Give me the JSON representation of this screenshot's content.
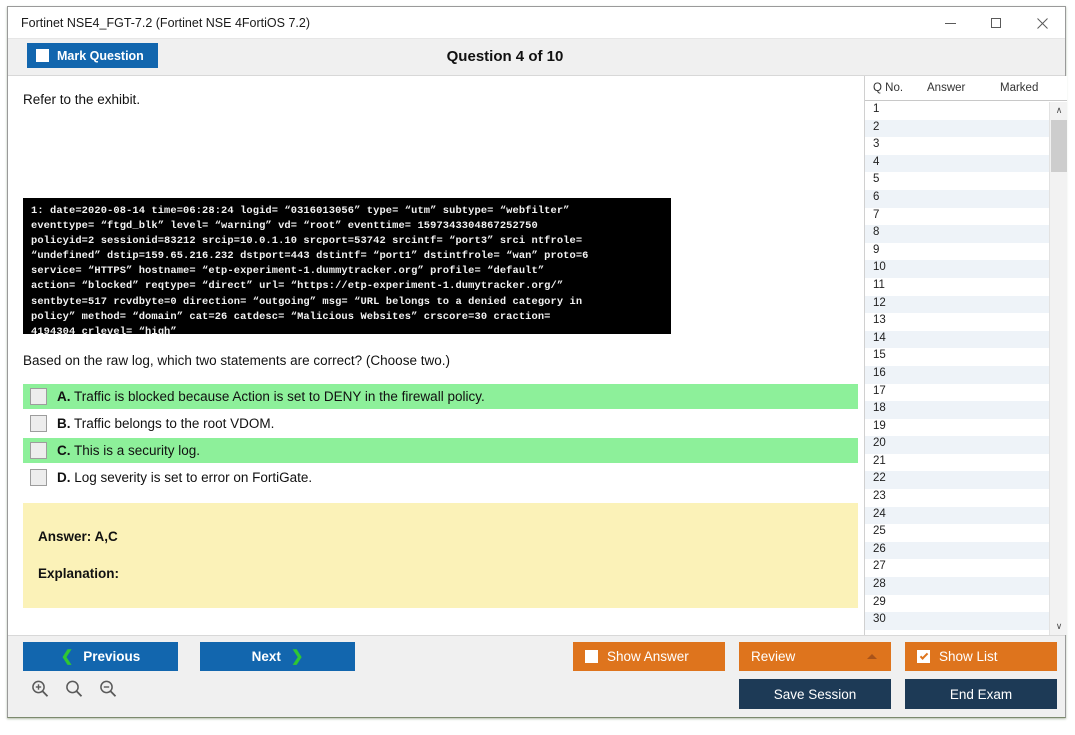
{
  "window": {
    "title": "Fortinet NSE4_FGT-7.2 (Fortinet NSE 4FortiOS 7.2)",
    "minimize_label": "–",
    "maximize_label": "□",
    "close_label": "×"
  },
  "header": {
    "mark_question_label": "Mark Question",
    "question_counter": "Question 4 of 10"
  },
  "main": {
    "refer_text": "Refer to the exhibit.",
    "exhibit_log": "1: date=2020-08-14 time=06:28:24 logid= “0316013056” type= “utm” subtype= “webfilter”\neventtype= “ftgd_blk” level= “warning” vd= “root” eventtime= 1597343304867252750\npolicyid=2 sessionid=83212 srcip=10.0.1.10 srcport=53742 srcintf= “port3” srci ntfrole=\n“undefined” dstip=159.65.216.232 dstport=443 dstintf= “port1” dstintfrole= “wan” proto=6\nservice= “HTTPS” hostname= “etp-experiment-1.dummytracker.org” profile= “default”\naction= “blocked” reqtype= “direct” url= “https://etp-experiment-1.dumytracker.org/”\nsentbyte=517 rcvdbyte=0 direction= “outgoing” msg= “URL belongs to a denied category in\npolicy” method= “domain” cat=26 catdesc= “Malicious Websites” crscore=30 craction=\n4194304 crlevel= “high”",
    "question_text": "Based on the raw log, which two statements are correct? (Choose two.)",
    "options": [
      {
        "letter": "A.",
        "text": "Traffic is blocked because Action is set to DENY in the firewall policy.",
        "highlighted": true,
        "checked": false
      },
      {
        "letter": "B.",
        "text": "Traffic belongs to the root VDOM.",
        "highlighted": false,
        "checked": false
      },
      {
        "letter": "C.",
        "text": "This is a security log.",
        "highlighted": true,
        "checked": false
      },
      {
        "letter": "D.",
        "text": "Log severity is set to error on FortiGate.",
        "highlighted": false,
        "checked": false
      }
    ],
    "answer_label": "Answer: A,C",
    "explanation_label": "Explanation:"
  },
  "question_list": {
    "columns": [
      "Q No.",
      "Answer",
      "Marked"
    ],
    "rows": [
      {
        "no": "1",
        "answer": "",
        "marked": ""
      },
      {
        "no": "2",
        "answer": "",
        "marked": ""
      },
      {
        "no": "3",
        "answer": "",
        "marked": ""
      },
      {
        "no": "4",
        "answer": "",
        "marked": ""
      },
      {
        "no": "5",
        "answer": "",
        "marked": ""
      },
      {
        "no": "6",
        "answer": "",
        "marked": ""
      },
      {
        "no": "7",
        "answer": "",
        "marked": ""
      },
      {
        "no": "8",
        "answer": "",
        "marked": ""
      },
      {
        "no": "9",
        "answer": "",
        "marked": ""
      },
      {
        "no": "10",
        "answer": "",
        "marked": ""
      },
      {
        "no": "11",
        "answer": "",
        "marked": ""
      },
      {
        "no": "12",
        "answer": "",
        "marked": ""
      },
      {
        "no": "13",
        "answer": "",
        "marked": ""
      },
      {
        "no": "14",
        "answer": "",
        "marked": ""
      },
      {
        "no": "15",
        "answer": "",
        "marked": ""
      },
      {
        "no": "16",
        "answer": "",
        "marked": ""
      },
      {
        "no": "17",
        "answer": "",
        "marked": ""
      },
      {
        "no": "18",
        "answer": "",
        "marked": ""
      },
      {
        "no": "19",
        "answer": "",
        "marked": ""
      },
      {
        "no": "20",
        "answer": "",
        "marked": ""
      },
      {
        "no": "21",
        "answer": "",
        "marked": ""
      },
      {
        "no": "22",
        "answer": "",
        "marked": ""
      },
      {
        "no": "23",
        "answer": "",
        "marked": ""
      },
      {
        "no": "24",
        "answer": "",
        "marked": ""
      },
      {
        "no": "25",
        "answer": "",
        "marked": ""
      },
      {
        "no": "26",
        "answer": "",
        "marked": ""
      },
      {
        "no": "27",
        "answer": "",
        "marked": ""
      },
      {
        "no": "28",
        "answer": "",
        "marked": ""
      },
      {
        "no": "29",
        "answer": "",
        "marked": ""
      },
      {
        "no": "30",
        "answer": "",
        "marked": ""
      }
    ],
    "scroll_up_glyph": "∧",
    "scroll_down_glyph": "∨"
  },
  "footer": {
    "previous_label": "Previous",
    "next_label": "Next",
    "prev_chevron": "❮",
    "next_chevron": "❯",
    "show_answer_label": "Show Answer",
    "show_answer_checked": false,
    "review_label": "Review",
    "show_list_label": "Show List",
    "show_list_checked": true,
    "save_session_label": "Save Session",
    "end_exam_label": "End Exam"
  },
  "colors": {
    "primary_blue": "#1266ae",
    "orange": "#de741d",
    "navy": "#1d3a56",
    "highlight_green": "#8df09a",
    "answer_yellow": "#fbf2b8",
    "chevron_green": "#2fc733"
  }
}
